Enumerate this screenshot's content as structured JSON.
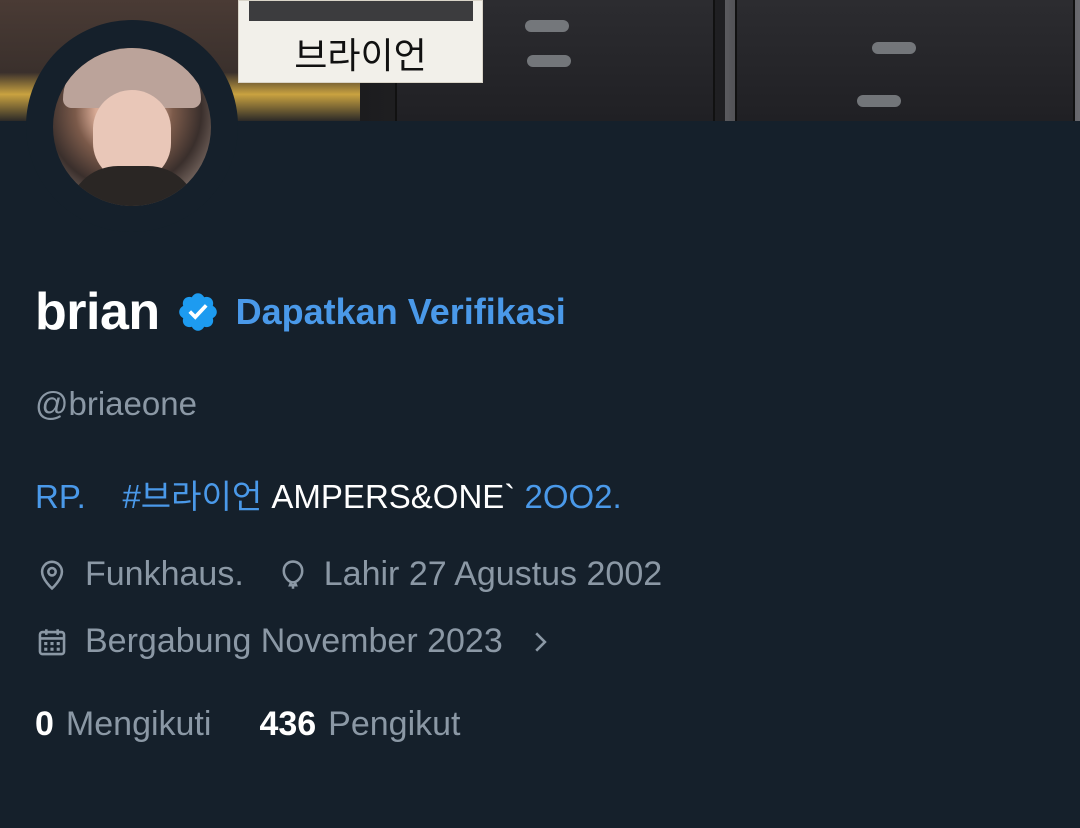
{
  "banner": {
    "label_text": "브라이언"
  },
  "profile": {
    "name": "brian",
    "get_verified_label": "Dapatkan Verifikasi",
    "handle": "@briaeone",
    "bio": {
      "part1": "RP.",
      "part2": "#브라이언",
      "part3": "AMPERS&ONE`",
      "part4": "2OO2."
    },
    "location": "Funkhaus.",
    "birth": "Lahir 27 Agustus 2002",
    "joined": "Bergabung November 2023"
  },
  "stats": {
    "following_count": "0",
    "following_label": "Mengikuti",
    "followers_count": "436",
    "followers_label": "Pengikut"
  },
  "colors": {
    "background": "#15202b",
    "accent": "#4a99e9",
    "secondary_text": "#8b98a5",
    "verified_badge": "#1d9bf0"
  },
  "icons": [
    "verified-badge-icon",
    "location-pin-icon",
    "balloon-icon",
    "calendar-icon",
    "chevron-right-icon"
  ]
}
